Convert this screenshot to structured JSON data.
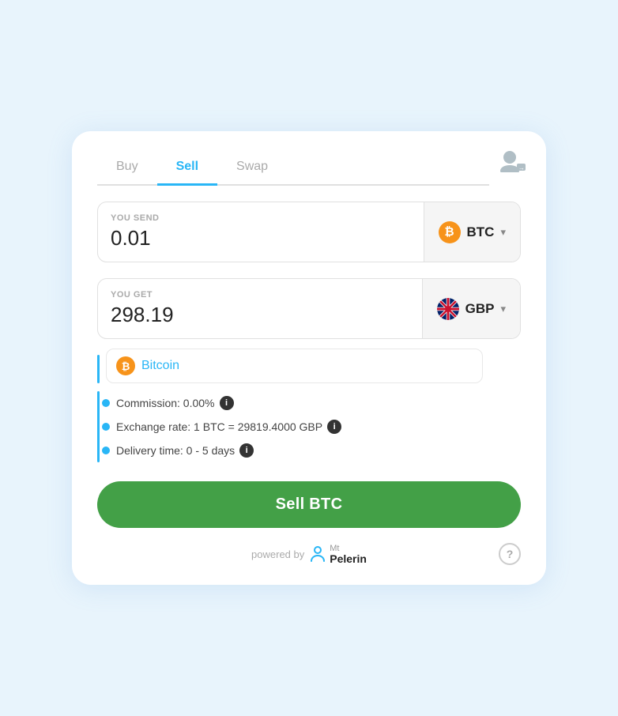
{
  "tabs": [
    {
      "label": "Buy",
      "active": false
    },
    {
      "label": "Sell",
      "active": true
    },
    {
      "label": "Swap",
      "active": false
    }
  ],
  "send_section": {
    "label": "YOU SEND",
    "value": "0.01",
    "currency": "BTC",
    "currency_icon": "₿"
  },
  "get_section": {
    "label": "YOU GET",
    "value": "298.19",
    "currency": "GBP"
  },
  "bitcoin_option": {
    "name": "Bitcoin"
  },
  "details": {
    "commission": "Commission: 0.00%",
    "exchange_rate": "Exchange rate: 1 BTC = 29819.4000 GBP",
    "delivery_time": "Delivery time: 0 - 5 days"
  },
  "sell_button": {
    "label": "Sell BTC"
  },
  "footer": {
    "powered_by": "powered by",
    "brand": "Mt\nPelerin"
  },
  "profile": {
    "arrow": "→"
  }
}
